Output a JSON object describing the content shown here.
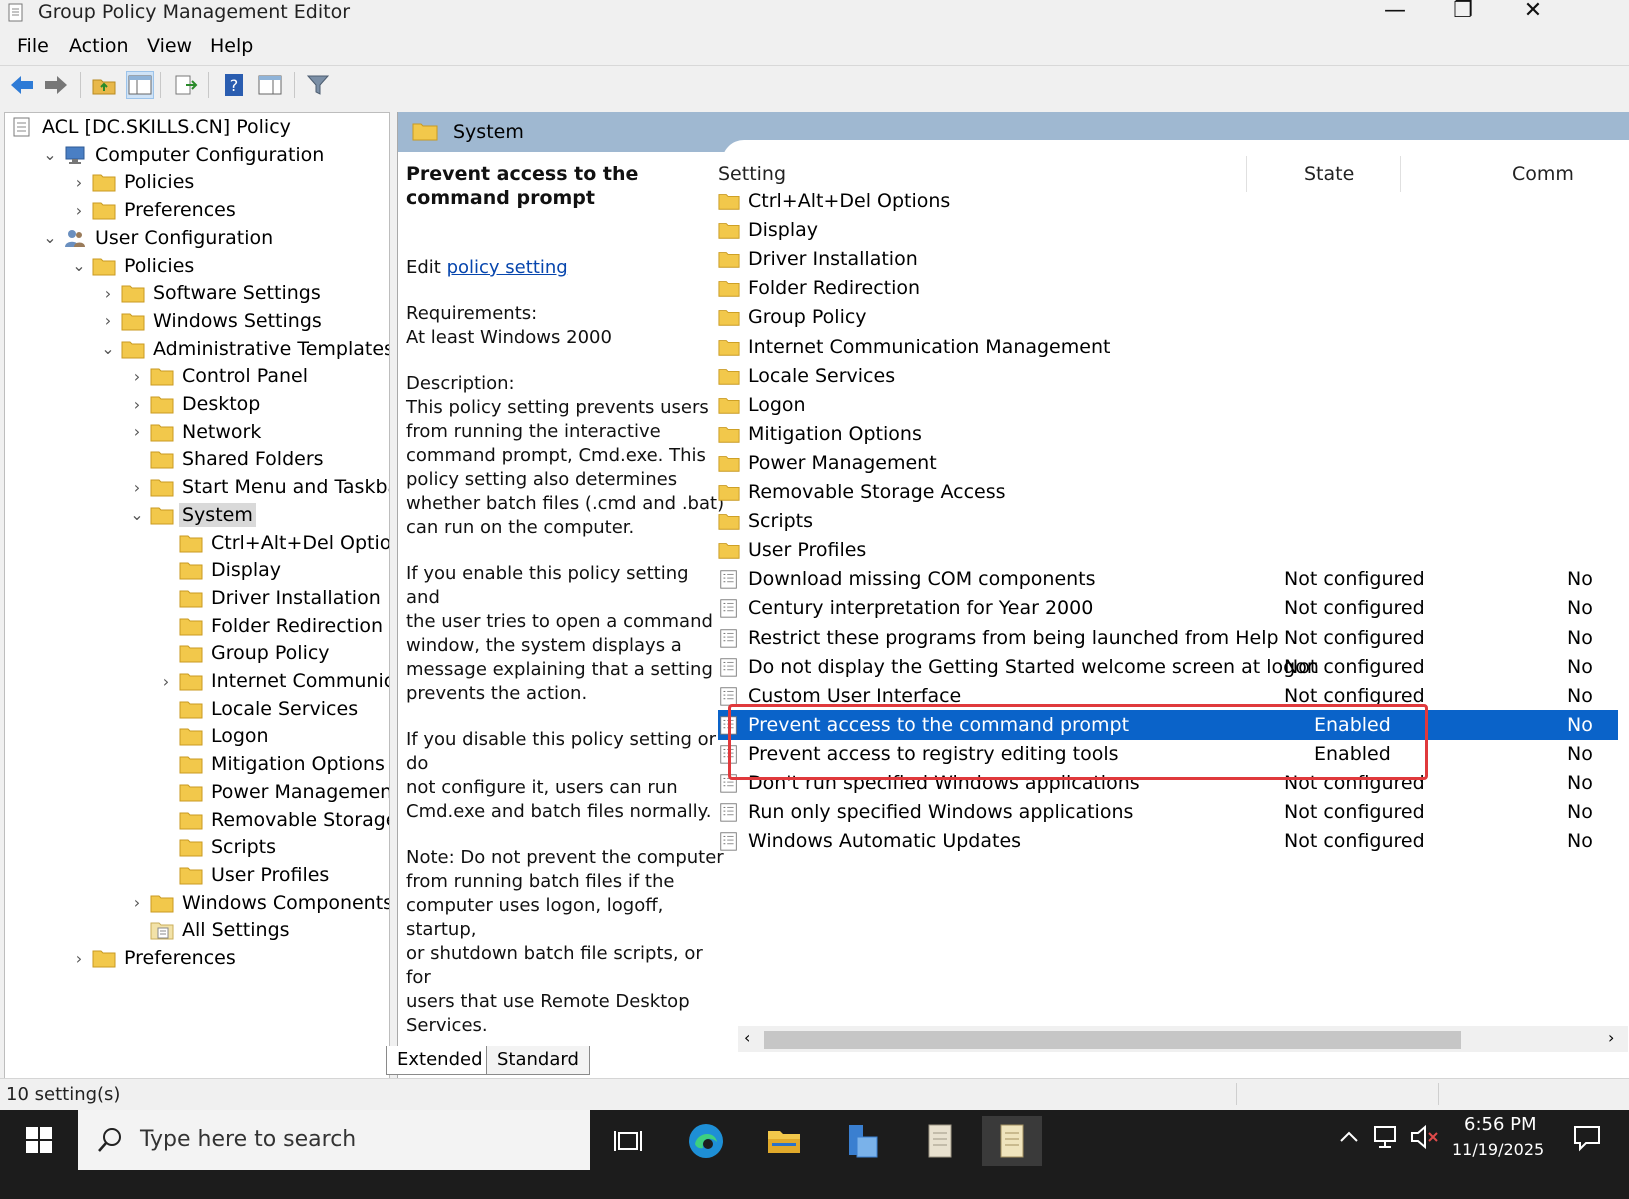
{
  "window": {
    "title": "Group Policy Management Editor",
    "min_glyph": "—",
    "restore_glyph": "❐",
    "close_glyph": "✕"
  },
  "menu": [
    "File",
    "Action",
    "View",
    "Help"
  ],
  "toolbar": {
    "icons": [
      "back-arrow-icon",
      "forward-arrow-icon",
      "up-folder-icon",
      "show-hide-tree-icon",
      "export-list-icon",
      "help-icon",
      "properties-icon",
      "filter-icon"
    ]
  },
  "tree": {
    "nodes": [
      {
        "label": "ACL [DC.SKILLS.CN] Policy",
        "icon": "policy-icon",
        "chevron": ""
      },
      {
        "label": "Computer Configuration",
        "icon": "computer-icon",
        "chevron": "⌄"
      },
      {
        "label": "Policies",
        "icon": "folder-icon",
        "chevron": "›"
      },
      {
        "label": "Preferences",
        "icon": "folder-icon",
        "chevron": "›"
      },
      {
        "label": "User Configuration",
        "icon": "users-icon",
        "chevron": "⌄"
      },
      {
        "label": "Policies",
        "icon": "folder-icon",
        "chevron": "⌄"
      },
      {
        "label": "Software Settings",
        "icon": "folder-icon",
        "chevron": "›"
      },
      {
        "label": "Windows Settings",
        "icon": "folder-icon",
        "chevron": "›"
      },
      {
        "label": "Administrative Templates: Poli",
        "icon": "folder-icon",
        "chevron": "⌄"
      },
      {
        "label": "Control Panel",
        "icon": "folder-icon",
        "chevron": "›"
      },
      {
        "label": "Desktop",
        "icon": "folder-icon",
        "chevron": "›"
      },
      {
        "label": "Network",
        "icon": "folder-icon",
        "chevron": "›"
      },
      {
        "label": "Shared Folders",
        "icon": "folder-icon",
        "chevron": ""
      },
      {
        "label": "Start Menu and Taskbar",
        "icon": "folder-icon",
        "chevron": "›"
      },
      {
        "label": "System",
        "icon": "folder-icon",
        "chevron": "⌄"
      },
      {
        "label": "Ctrl+Alt+Del Options",
        "icon": "folder-icon",
        "chevron": ""
      },
      {
        "label": "Display",
        "icon": "folder-icon",
        "chevron": ""
      },
      {
        "label": "Driver Installation",
        "icon": "folder-icon",
        "chevron": ""
      },
      {
        "label": "Folder Redirection",
        "icon": "folder-icon",
        "chevron": ""
      },
      {
        "label": "Group Policy",
        "icon": "folder-icon",
        "chevron": ""
      },
      {
        "label": "Internet Communicatio",
        "icon": "folder-icon",
        "chevron": "›"
      },
      {
        "label": "Locale Services",
        "icon": "folder-icon",
        "chevron": ""
      },
      {
        "label": "Logon",
        "icon": "folder-icon",
        "chevron": ""
      },
      {
        "label": "Mitigation Options",
        "icon": "folder-icon",
        "chevron": ""
      },
      {
        "label": "Power Management",
        "icon": "folder-icon",
        "chevron": ""
      },
      {
        "label": "Removable Storage Ac",
        "icon": "folder-icon",
        "chevron": ""
      },
      {
        "label": "Scripts",
        "icon": "folder-icon",
        "chevron": ""
      },
      {
        "label": "User Profiles",
        "icon": "folder-icon",
        "chevron": ""
      },
      {
        "label": "Windows Components",
        "icon": "folder-icon",
        "chevron": "›"
      },
      {
        "label": "All Settings",
        "icon": "all-settings-icon",
        "chevron": ""
      },
      {
        "label": "Preferences",
        "icon": "folder-icon",
        "chevron": "›"
      }
    ]
  },
  "header": {
    "title": "System"
  },
  "description": {
    "title": "Prevent access to the command prompt",
    "edit_prefix": "Edit ",
    "edit_link": "policy setting",
    "requirements": "Requirements:\nAt least Windows 2000",
    "description": "Description:\nThis policy setting prevents users\nfrom running the interactive\ncommand prompt, Cmd.exe.  This\npolicy setting also determines\nwhether batch files (.cmd and .bat)\ncan run on the computer.",
    "enable_text": "If you enable this policy setting and\nthe user tries to open a command\nwindow, the system displays a\nmessage explaining that a setting\nprevents the action.",
    "disable_text": "If you disable this policy setting or do\nnot configure it, users can run\nCmd.exe and batch files normally.",
    "note_text": "Note: Do not prevent the computer\nfrom running batch files if the\ncomputer uses logon, logoff, startup,\nor shutdown batch file scripts, or for\nusers that use Remote Desktop\nServices."
  },
  "list": {
    "headers": {
      "setting": "Setting",
      "state": "State",
      "comment": "Comm"
    },
    "rows": [
      {
        "name": "Ctrl+Alt+Del Options",
        "type": "folder",
        "state": "",
        "comment": ""
      },
      {
        "name": "Display",
        "type": "folder",
        "state": "",
        "comment": ""
      },
      {
        "name": "Driver Installation",
        "type": "folder",
        "state": "",
        "comment": ""
      },
      {
        "name": "Folder Redirection",
        "type": "folder",
        "state": "",
        "comment": ""
      },
      {
        "name": "Group Policy",
        "type": "folder",
        "state": "",
        "comment": ""
      },
      {
        "name": "Internet Communication Management",
        "type": "folder",
        "state": "",
        "comment": ""
      },
      {
        "name": "Locale Services",
        "type": "folder",
        "state": "",
        "comment": ""
      },
      {
        "name": "Logon",
        "type": "folder",
        "state": "",
        "comment": ""
      },
      {
        "name": "Mitigation Options",
        "type": "folder",
        "state": "",
        "comment": ""
      },
      {
        "name": "Power Management",
        "type": "folder",
        "state": "",
        "comment": ""
      },
      {
        "name": "Removable Storage Access",
        "type": "folder",
        "state": "",
        "comment": ""
      },
      {
        "name": "Scripts",
        "type": "folder",
        "state": "",
        "comment": ""
      },
      {
        "name": "User Profiles",
        "type": "folder",
        "state": "",
        "comment": ""
      },
      {
        "name": "Download missing COM components",
        "type": "setting",
        "state": "Not configured",
        "comment": "No"
      },
      {
        "name": "Century interpretation for Year 2000",
        "type": "setting",
        "state": "Not configured",
        "comment": "No"
      },
      {
        "name": "Restrict these programs from being launched from Help",
        "type": "setting",
        "state": "Not configured",
        "comment": "No"
      },
      {
        "name": "Do not display the Getting Started welcome screen at logon",
        "type": "setting",
        "state": "Not configured",
        "comment": "No"
      },
      {
        "name": "Custom User Interface",
        "type": "setting",
        "state": "Not configured",
        "comment": "No"
      },
      {
        "name": "Prevent access to the command prompt",
        "type": "setting",
        "state": "Enabled",
        "comment": "No",
        "selected": true
      },
      {
        "name": "Prevent access to registry editing tools",
        "type": "setting",
        "state": "Enabled",
        "comment": "No"
      },
      {
        "name": "Don't run specified Windows applications",
        "type": "setting",
        "state": "Not configured",
        "comment": "No"
      },
      {
        "name": "Run only specified Windows applications",
        "type": "setting",
        "state": "Not configured",
        "comment": "No"
      },
      {
        "name": "Windows Automatic Updates",
        "type": "setting",
        "state": "Not configured",
        "comment": "No"
      }
    ]
  },
  "tabs": [
    "Extended",
    "Standard"
  ],
  "status": {
    "text": "10 setting(s)"
  },
  "taskbar": {
    "search_placeholder": "Type here to search",
    "time": "6:56 PM",
    "date": "11/19/2025",
    "apps": [
      "task-view-icon",
      "edge-icon",
      "file-explorer-icon",
      "server-manager-icon",
      "gpo-editor-icon",
      "gpo-editor-active-icon"
    ]
  },
  "colors": {
    "selection": "#0a63c9",
    "header_band": "#9fb8d1",
    "highlight_box": "#e0393c",
    "folder": "#f2c84b"
  }
}
